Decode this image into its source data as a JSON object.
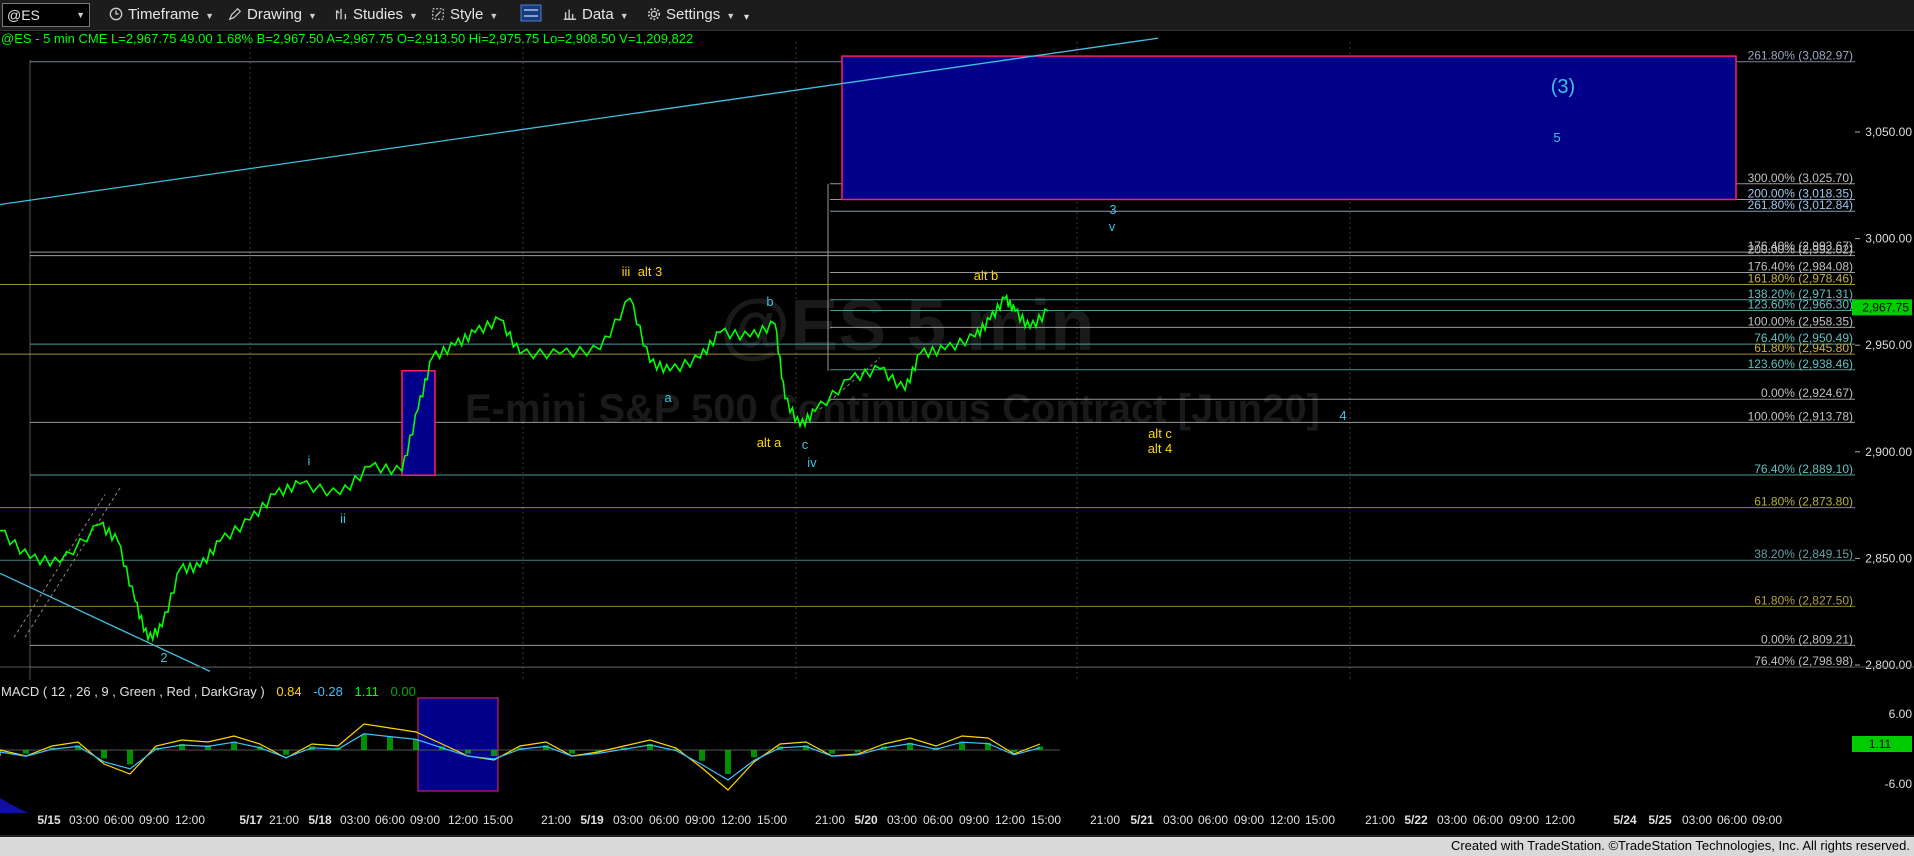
{
  "toolbar": {
    "symbol": "@ES",
    "timeframe": "Timeframe",
    "drawing": "Drawing",
    "studies": "Studies",
    "style": "Style",
    "data": "Data",
    "settings": "Settings"
  },
  "header": {
    "symbol_info": "@ES - 5 min  CME  L=2,967.75  49.00  1.68%  B=2,967.50  A=2,967.75  O=2,913.50  Hi=2,975.75  Lo=2,908.50  V=1,209,822"
  },
  "watermark": {
    "symbol": "@ES 5 min",
    "name": "E-mini S&P 500 Continuous Contract [Jun20]"
  },
  "colors": {
    "price_line": "#00ff00",
    "target_box": "#00008b",
    "target_box_border": "#ff2060",
    "wave_label_cyan": "#40c0e0",
    "wave_label_yellow": "#ffd700",
    "last_price_badge": "#00cc00"
  },
  "chart_data": {
    "type": "line",
    "ylim": [
      2790,
      3092
    ],
    "y_ticks": [
      "3,050.00",
      "3,000.00",
      "2,950.00",
      "2,900.00",
      "2,850.00",
      "2,800.00"
    ],
    "last_price": "2,967.75",
    "x_ticks": [
      "5/15",
      "03:00",
      "06:00",
      "09:00",
      "12:00",
      "5/17",
      "21:00",
      "5/18",
      "03:00",
      "06:00",
      "09:00",
      "12:00",
      "15:00",
      "21:00",
      "5/19",
      "03:00",
      "06:00",
      "09:00",
      "12:00",
      "15:00",
      "21:00",
      "5/20",
      "03:00",
      "06:00",
      "09:00",
      "12:00",
      "15:00",
      "21:00",
      "5/21",
      "03:00",
      "06:00",
      "09:00",
      "12:00",
      "15:00",
      "21:00",
      "5/22",
      "03:00",
      "06:00",
      "09:00",
      "12:00",
      "5/24",
      "5/25",
      "03:00",
      "06:00",
      "09:00"
    ],
    "fib_levels": [
      {
        "label": "261.80% (3,082.97)",
        "value": 3082.97
      },
      {
        "label": "300.00% (3,025.70)",
        "value": 3025.7
      },
      {
        "label": "200.00% (3,018.35)",
        "value": 3018.35
      },
      {
        "label": "261.80% (3,012.84)",
        "value": 3012.84
      },
      {
        "label": "176.40% (2,993.67)",
        "value": 2993.67
      },
      {
        "label": "200.00% (2,992.02)",
        "value": 2992.02
      },
      {
        "label": "176.40% (2,984.08)",
        "value": 2984.08
      },
      {
        "label": "161.80% (2,978.46)",
        "value": 2978.46
      },
      {
        "label": "138.20% (2,971.31)",
        "value": 2971.31
      },
      {
        "label": "123.60% (2,966.30)",
        "value": 2966.3
      },
      {
        "label": "100.00% (2,958.35)",
        "value": 2958.35
      },
      {
        "label": "76.40% (2,950.49)",
        "value": 2950.49
      },
      {
        "label": "61.80% (2,945.80)",
        "value": 2945.8
      },
      {
        "label": "123.60% (2,938.46)",
        "value": 2938.46
      },
      {
        "label": "0.00% (2,924.67)",
        "value": 2924.67
      },
      {
        "label": "100.00% (2,913.78)",
        "value": 2913.78
      },
      {
        "label": "76.40% (2,889.10)",
        "value": 2889.1
      },
      {
        "label": "61.80% (2,873.80)",
        "value": 2873.8
      },
      {
        "label": "38.20% (2,849.15)",
        "value": 2849.15
      },
      {
        "label": "61.80% (2,827.50)",
        "value": 2827.5
      },
      {
        "label": "0.00% (2,809.21)",
        "value": 2809.21
      },
      {
        "label": "76.40% (2,798.98)",
        "value": 2798.98
      }
    ],
    "wave_labels": [
      {
        "text": "(3)",
        "color": "cyan"
      },
      {
        "text": "5",
        "color": "cyan"
      },
      {
        "text": "3",
        "color": "cyan"
      },
      {
        "text": "v",
        "color": "cyan"
      },
      {
        "text": "iii",
        "color": "yellow"
      },
      {
        "text": "alt 3",
        "color": "yellow"
      },
      {
        "text": "b",
        "color": "cyan"
      },
      {
        "text": "alt b",
        "color": "yellow"
      },
      {
        "text": "a",
        "color": "cyan"
      },
      {
        "text": "alt a",
        "color": "yellow"
      },
      {
        "text": "c",
        "color": "cyan"
      },
      {
        "text": "iv",
        "color": "cyan"
      },
      {
        "text": "4",
        "color": "cyan"
      },
      {
        "text": "alt c",
        "color": "yellow"
      },
      {
        "text": "alt 4",
        "color": "yellow"
      },
      {
        "text": "i",
        "color": "cyan"
      },
      {
        "text": "ii",
        "color": "cyan"
      },
      {
        "text": "2",
        "color": "cyan"
      }
    ],
    "macd": {
      "label_name": "MACD ( 12 , 26 , 9 , Green , Red , DarkGray )",
      "macd": "0.84",
      "signal": "-0.28",
      "diff": "1.11",
      "zero": "0.00",
      "y_ticks": [
        "6.00",
        "-6.00"
      ],
      "last_value": "1.11"
    }
  },
  "status": {
    "credit": "Created with TradeStation. ©TradeStation Technologies, Inc. All rights reserved."
  }
}
